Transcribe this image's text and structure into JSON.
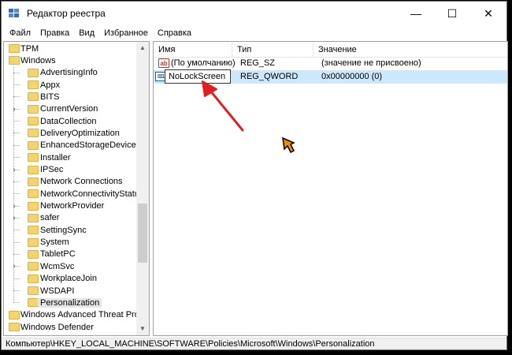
{
  "window": {
    "title": "Редактор реестра",
    "icon": "registry-editor-icon"
  },
  "window_controls": {
    "minimize": "—",
    "maximize": "☐",
    "close": "✕"
  },
  "menu": [
    "Файл",
    "Правка",
    "Вид",
    "Избранное",
    "Справка"
  ],
  "tree": {
    "items": [
      {
        "label": "TPM",
        "level": 0,
        "expandable": false
      },
      {
        "label": "Windows",
        "level": 0,
        "expandable": false
      },
      {
        "label": "AdvertisingInfo",
        "level": 1,
        "expandable": false
      },
      {
        "label": "Appx",
        "level": 1,
        "expandable": false
      },
      {
        "label": "BITS",
        "level": 1,
        "expandable": false
      },
      {
        "label": "CurrentVersion",
        "level": 1,
        "expandable": true
      },
      {
        "label": "DataCollection",
        "level": 1,
        "expandable": false
      },
      {
        "label": "DeliveryOptimization",
        "level": 1,
        "expandable": false
      },
      {
        "label": "EnhancedStorageDevices",
        "level": 1,
        "expandable": false
      },
      {
        "label": "Installer",
        "level": 1,
        "expandable": false
      },
      {
        "label": "IPSec",
        "level": 1,
        "expandable": true
      },
      {
        "label": "Network Connections",
        "level": 1,
        "expandable": false
      },
      {
        "label": "NetworkConnectivityStatusInd",
        "level": 1,
        "expandable": false
      },
      {
        "label": "NetworkProvider",
        "level": 1,
        "expandable": true
      },
      {
        "label": "safer",
        "level": 1,
        "expandable": true
      },
      {
        "label": "SettingSync",
        "level": 1,
        "expandable": false
      },
      {
        "label": "System",
        "level": 1,
        "expandable": false
      },
      {
        "label": "TabletPC",
        "level": 1,
        "expandable": false
      },
      {
        "label": "WcmSvc",
        "level": 1,
        "expandable": true
      },
      {
        "label": "WorkplaceJoin",
        "level": 1,
        "expandable": false
      },
      {
        "label": "WSDAPI",
        "level": 1,
        "expandable": false
      },
      {
        "label": "Personalization",
        "level": 1,
        "expandable": false,
        "selected": true
      },
      {
        "label": "Windows Advanced Threat Prote",
        "level": 0,
        "expandable": false
      },
      {
        "label": "Windows Defender",
        "level": 0,
        "expandable": false
      }
    ]
  },
  "list": {
    "columns": [
      "Имя",
      "Тип",
      "Значение"
    ],
    "rows": [
      {
        "icon": "string-value-icon",
        "icon_text": "ab",
        "name": "(По умолчанию)",
        "type": "REG_SZ",
        "data": "(значение не присвоено)"
      },
      {
        "icon": "binary-value-icon",
        "icon_text": "011",
        "name": "NoLockScreen",
        "type": "REG_QWORD",
        "data": "0x00000000 (0)",
        "selected": true,
        "renaming": true
      }
    ]
  },
  "annotation": {
    "arrow_color": "#e02020"
  },
  "statusbar": {
    "path": "Компьютер\\HKEY_LOCAL_MACHINE\\SOFTWARE\\Policies\\Microsoft\\Windows\\Personalization"
  }
}
